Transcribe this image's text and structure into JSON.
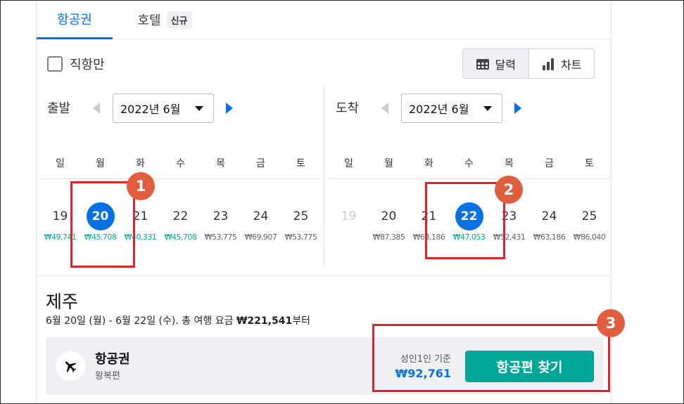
{
  "tabs": {
    "flights": "항공권",
    "hotels": "호텔",
    "hotels_badge": "신규"
  },
  "filters": {
    "direct_only": "직항만"
  },
  "view_toggle": {
    "calendar": "달력",
    "chart": "차트"
  },
  "departure": {
    "label": "출발",
    "month": "2022년 6월",
    "weekdays": [
      "일",
      "월",
      "화",
      "수",
      "목",
      "금",
      "토"
    ],
    "days": [
      {
        "day": "19",
        "price": "₩49,741",
        "color": "green",
        "selected": false,
        "muted": false
      },
      {
        "day": "20",
        "price": "₩45,708",
        "color": "green",
        "selected": true,
        "muted": false
      },
      {
        "day": "21",
        "price": "₩40,331",
        "color": "green",
        "selected": false,
        "muted": false
      },
      {
        "day": "22",
        "price": "₩45,708",
        "color": "green",
        "selected": false,
        "muted": false
      },
      {
        "day": "23",
        "price": "₩53,775",
        "color": "gray",
        "selected": false,
        "muted": false
      },
      {
        "day": "24",
        "price": "₩69,907",
        "color": "gray",
        "selected": false,
        "muted": false
      },
      {
        "day": "25",
        "price": "₩53,775",
        "color": "gray",
        "selected": false,
        "muted": false
      }
    ]
  },
  "arrival": {
    "label": "도착",
    "month": "2022년 6월",
    "weekdays": [
      "일",
      "월",
      "화",
      "수",
      "목",
      "금",
      "토"
    ],
    "days": [
      {
        "day": "19",
        "price": "",
        "color": "gray",
        "selected": false,
        "muted": true
      },
      {
        "day": "20",
        "price": "₩87,385",
        "color": "gray",
        "selected": false,
        "muted": false
      },
      {
        "day": "21",
        "price": "₩63,186",
        "color": "gray",
        "selected": false,
        "muted": false
      },
      {
        "day": "22",
        "price": "₩47,053",
        "color": "green",
        "selected": true,
        "muted": false
      },
      {
        "day": "23",
        "price": "₩52,431",
        "color": "gray",
        "selected": false,
        "muted": false
      },
      {
        "day": "24",
        "price": "₩63,186",
        "color": "gray",
        "selected": false,
        "muted": false
      },
      {
        "day": "25",
        "price": "₩86,040",
        "color": "gray",
        "selected": false,
        "muted": false
      }
    ]
  },
  "trip": {
    "destination": "제주",
    "summary_prefix": "6월 20일 (월) - 6월 22일 (수). 총 여행 요금 ",
    "summary_total": "₩221,541",
    "summary_suffix": "부터"
  },
  "result": {
    "title": "항공권",
    "subtitle": "왕복편",
    "price_note": "성인1인 기준",
    "price": "₩92,761",
    "button": "항공편 찾기"
  },
  "annotations": [
    "1",
    "2",
    "3"
  ],
  "colors": {
    "accent": "#0770e3",
    "green": "#00a698",
    "annotation_red": "#d9262c",
    "marker": "#e05e3e"
  }
}
